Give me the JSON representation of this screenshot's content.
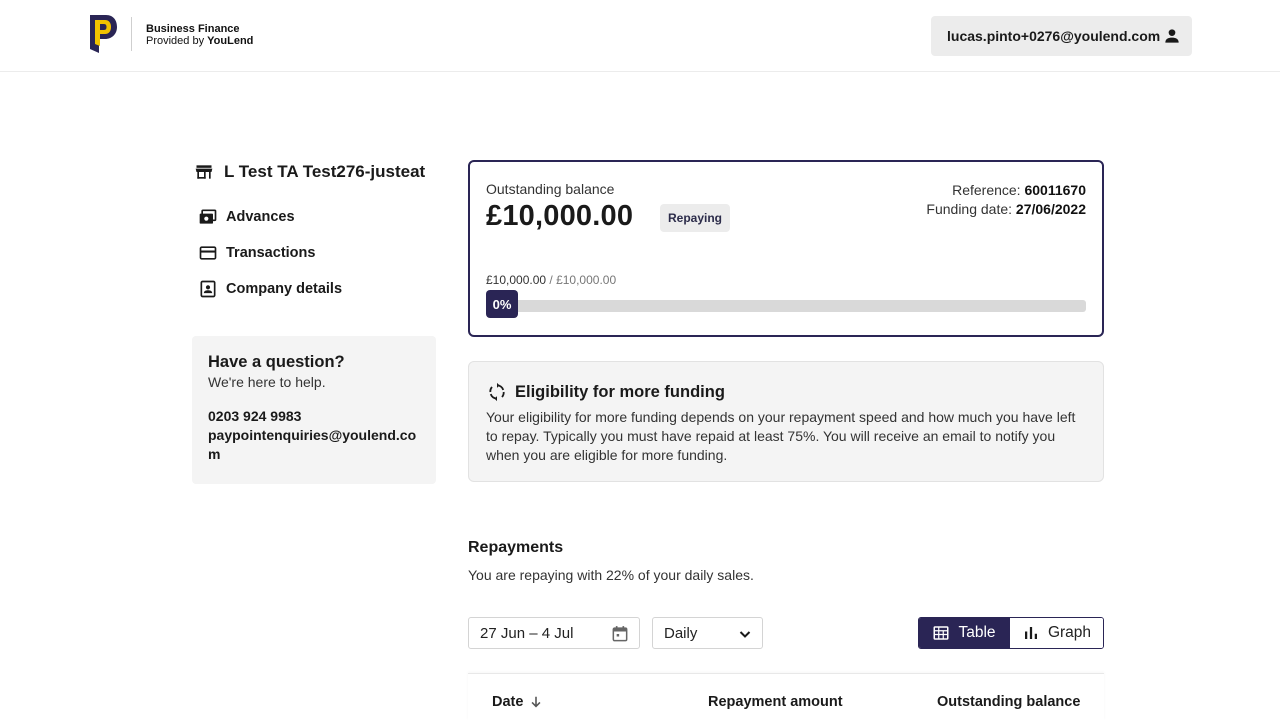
{
  "header": {
    "brand_line1": "Business Finance",
    "brand_line2_prefix": "Provided by ",
    "brand_line2_name": "YouLend",
    "user_email": "lucas.pinto+0276@youlend.com",
    "brand_colors": {
      "yellow": "#f2c200",
      "navy": "#2a2555"
    }
  },
  "sidebar": {
    "company_name": "L Test TA Test276-justeat",
    "nav": [
      {
        "label": "Advances",
        "icon": "money-icon"
      },
      {
        "label": "Transactions",
        "icon": "card-icon"
      },
      {
        "label": "Company details",
        "icon": "contact-icon"
      }
    ],
    "help": {
      "title": "Have a question?",
      "subtitle": "We're here to help.",
      "phone": "0203 924 9983",
      "email": "paypointenquiries@youlend.com"
    }
  },
  "balance": {
    "label": "Outstanding balance",
    "amount": "£10,000.00",
    "status": "Repaying",
    "reference_label": "Reference: ",
    "reference_value": "60011670",
    "funding_label": "Funding date: ",
    "funding_value": "27/06/2022",
    "progress_current": "£10,000.00",
    "progress_total": " / £10,000.00",
    "progress_percent_label": "0%",
    "progress_fraction": 0
  },
  "eligibility": {
    "title": "Eligibility for more funding",
    "body": "Your eligibility for more funding depends on your repayment speed and how much you have left to repay. Typically you must have repaid at least 75%. You will receive an email to notify you when you are eligible for more funding."
  },
  "repayments": {
    "title": "Repayments",
    "subtitle": "You are repaying with 22% of your daily sales.",
    "date_range": "27 Jun – 4 Jul",
    "period": "Daily",
    "view_table": "Table",
    "view_graph": "Graph",
    "columns": [
      "Date",
      "Repayment amount",
      "Outstanding balance"
    ]
  }
}
